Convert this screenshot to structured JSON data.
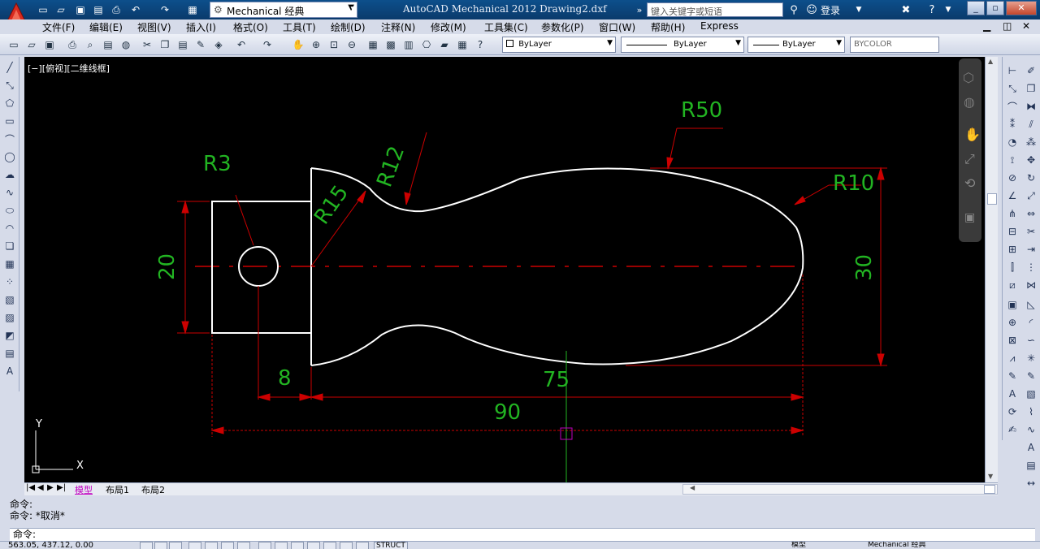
{
  "title_bar": {
    "workspace": "Mechanical 经典",
    "app_title": "AutoCAD Mechanical 2012    Drawing2.dxf",
    "search_placeholder": "键入关键字或短语",
    "login": "登录",
    "window_controls": [
      "_",
      "▫",
      "✕"
    ]
  },
  "menu": [
    "文件(F)",
    "编辑(E)",
    "视图(V)",
    "插入(I)",
    "格式(O)",
    "工具(T)",
    "绘制(D)",
    "注释(N)",
    "修改(M)",
    "工具集(C)",
    "参数化(P)",
    "窗口(W)",
    "帮助(H)",
    "Express"
  ],
  "properties": {
    "layer": "ByLayer",
    "linetype": "ByLayer",
    "lineweight": "ByLayer",
    "color": "BYCOLOR"
  },
  "viewport_label": "[−][俯视][二维线框]",
  "drawing": {
    "dimensions": {
      "r3": "R3",
      "r15": "R15",
      "r12": "R12",
      "r50": "R50",
      "r10": "R10",
      "d20": "20",
      "d30": "30",
      "d8": "8",
      "d75": "75",
      "d90": "90"
    },
    "ucs": {
      "x": "X",
      "y": "Y"
    }
  },
  "layout_tabs": [
    "模型",
    "布局1",
    "布局2"
  ],
  "command": {
    "history": [
      "命令:",
      "命令: *取消*"
    ],
    "prompt": "命令:"
  },
  "status": {
    "coords": "563.05, 437.12, 0.00",
    "toggle_struct": "STRUCT",
    "model": "模型",
    "workspace": "Mechanical 经典"
  },
  "colors": {
    "title_bg": "#0d4f8b",
    "canvas_bg": "#000000",
    "outline": "#ffffff",
    "dimension": "#cc0000",
    "dim_text": "#22b422",
    "tab_active": "#c000c0"
  }
}
